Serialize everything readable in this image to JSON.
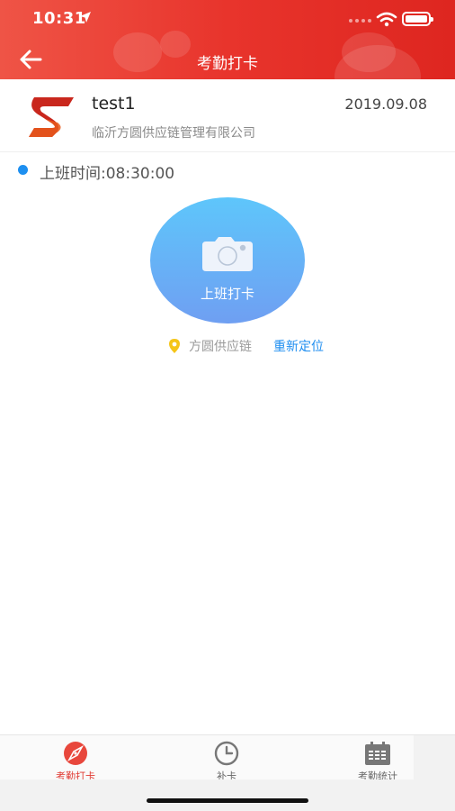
{
  "status_bar": {
    "time": "10:31"
  },
  "nav": {
    "title": "考勤打卡",
    "back_icon": "arrow-left-icon"
  },
  "user": {
    "name": "test1",
    "date": "2019.09.08",
    "company": "临沂方圆供应链管理有限公司"
  },
  "shift": {
    "label": "上班时间:08:30:00"
  },
  "punch": {
    "label": "上班打卡",
    "icon": "camera-icon"
  },
  "location": {
    "name": "方圆供应链",
    "relocate": "重新定位",
    "icon": "location-pin-icon"
  },
  "tabs": [
    {
      "label": "考勤打卡",
      "icon": "compass-icon",
      "active": true
    },
    {
      "label": "补卡",
      "icon": "clock-icon",
      "active": false
    },
    {
      "label": "考勤统计",
      "icon": "calendar-icon",
      "active": false
    }
  ],
  "colors": {
    "header": "#e8342c",
    "accent_blue": "#1f8ef0",
    "active_tab": "#e03a32",
    "punch_top": "#5ec6fb",
    "punch_bottom": "#6f9ff2"
  }
}
